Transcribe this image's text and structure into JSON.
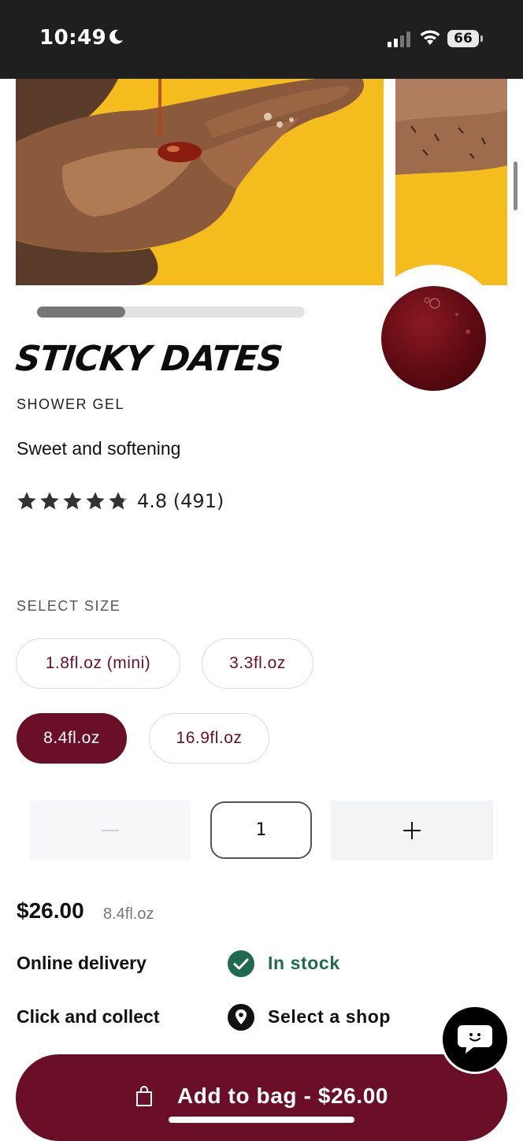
{
  "status_bar": {
    "time": "10:49",
    "battery": "66"
  },
  "gallery": {
    "image_count_progress": 0.33
  },
  "product": {
    "name": "STICKY DATES",
    "type": "SHOWER GEL",
    "tagline": "Sweet and softening",
    "rating": {
      "stars": 4.8,
      "text": "4.8 (491)"
    },
    "swatch_color": "#5e0a12"
  },
  "size_selector": {
    "label": "SELECT SIZE",
    "options": [
      "1.8fl.oz (mini)",
      "3.3fl.oz",
      "8.4fl.oz",
      "16.9fl.oz"
    ],
    "selected": "8.4fl.oz"
  },
  "quantity": {
    "minus": "−",
    "value": "1",
    "plus": "+"
  },
  "pricing": {
    "price": "$26.00",
    "size": "8.4fl.oz"
  },
  "availability": {
    "online_label": "Online delivery",
    "online_status": "In stock",
    "online_status_color": "#1e6b4e",
    "collect_label": "Click and collect",
    "collect_action": "Select a shop"
  },
  "cta": {
    "label": "Add to bag - $26.00",
    "icon": "bag-icon"
  },
  "chat": {
    "icon": "chat-icon"
  },
  "colors": {
    "brand": "#6a0f27",
    "image_bg": "#f4bd1d"
  }
}
